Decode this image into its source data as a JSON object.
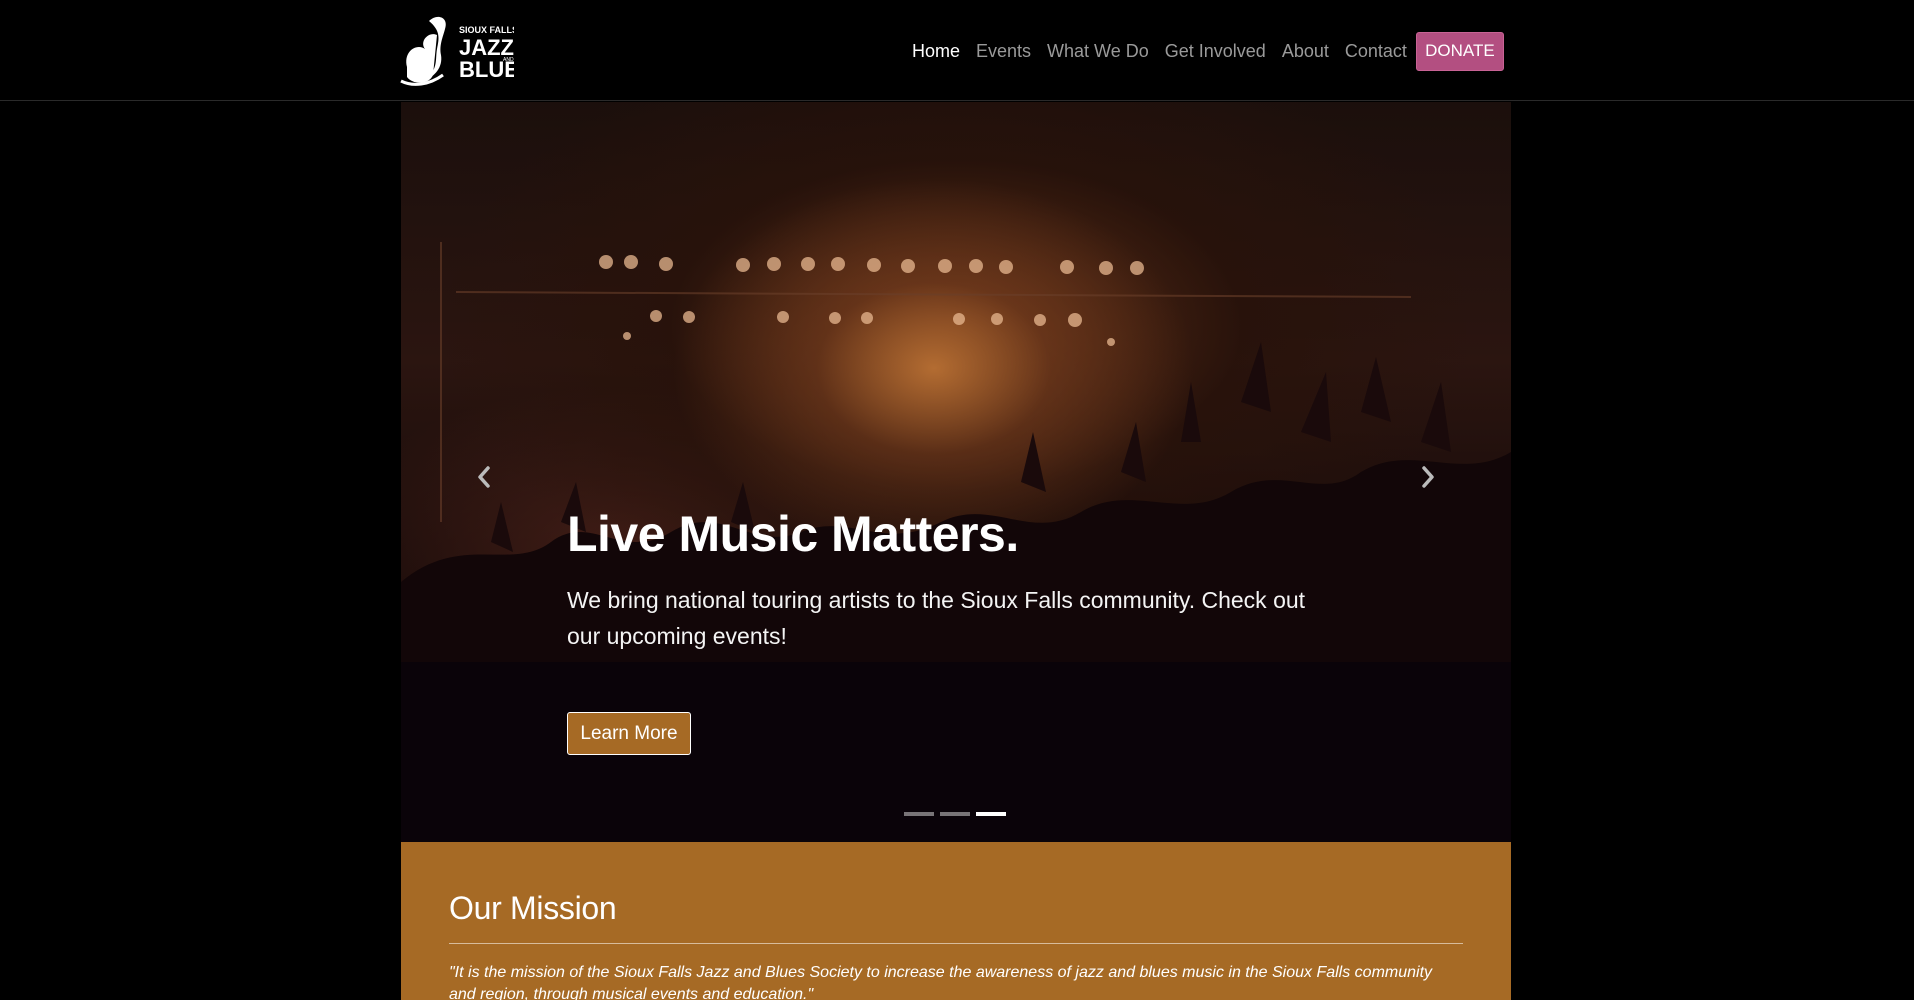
{
  "logo": {
    "alt": "Sioux Falls Jazz and Blues",
    "line1": "SIOUX FALLS",
    "line2": "JAZZ",
    "and": "AND",
    "line3": "BLUES"
  },
  "nav": {
    "items": [
      {
        "label": "Home",
        "active": true
      },
      {
        "label": "Events",
        "active": false
      },
      {
        "label": "What We Do",
        "active": false
      },
      {
        "label": "Get Involved",
        "active": false
      },
      {
        "label": "About",
        "active": false
      },
      {
        "label": "Contact",
        "active": false
      }
    ],
    "donate_label": "DONATE"
  },
  "hero": {
    "title": "Live Music Matters.",
    "text": "We bring national touring artists to the Sioux Falls community. Check out our upcoming events!",
    "button_label": "Learn More",
    "slide_count": 3,
    "active_slide": 3
  },
  "mission": {
    "heading": "Our Mission",
    "text": "\"It is the mission of the Sioux Falls Jazz and Blues Society to increase the awareness of jazz and blues music in the Sioux Falls community and region, through musical events and education.\""
  },
  "colors": {
    "donate": "#b34f81",
    "accent": "#a66a25",
    "background": "#000000"
  },
  "icons": {
    "prev": "chevron-left-icon",
    "next": "chevron-right-icon"
  }
}
